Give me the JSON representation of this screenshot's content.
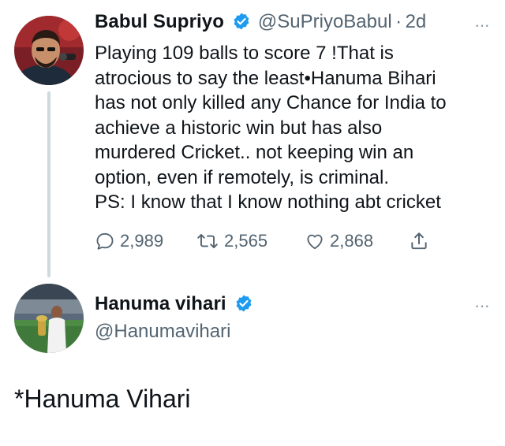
{
  "tweet1": {
    "display_name": "Babul Supriyo",
    "handle": "@SuPriyoBabul",
    "separator": "·",
    "time": "2d",
    "verified": true,
    "text": "Playing 109 balls to score 7 !That is\natrocious to say the least•Hanuma Bihari\nhas not only killed any Chance for India to\nachieve a historic win but has also\nmurdered Cricket.. not keeping win an\noption, even if remotely, is criminal.\nPS: I know that I know nothing abt cricket",
    "replies": "2,989",
    "retweets": "2,565",
    "likes": "2,868",
    "icons": [
      "reply-icon",
      "retweet-icon",
      "like-icon",
      "share-icon",
      "more-icon"
    ]
  },
  "tweet2": {
    "display_name": "Hanuma vihari",
    "handle": "@Hanumavihari",
    "verified": true
  },
  "correction": "*Hanuma Vihari",
  "colors": {
    "text": "#0f1419",
    "secondary": "#536471",
    "verified_blue": "#1d9bf0",
    "thread_line": "#cfd9de"
  }
}
